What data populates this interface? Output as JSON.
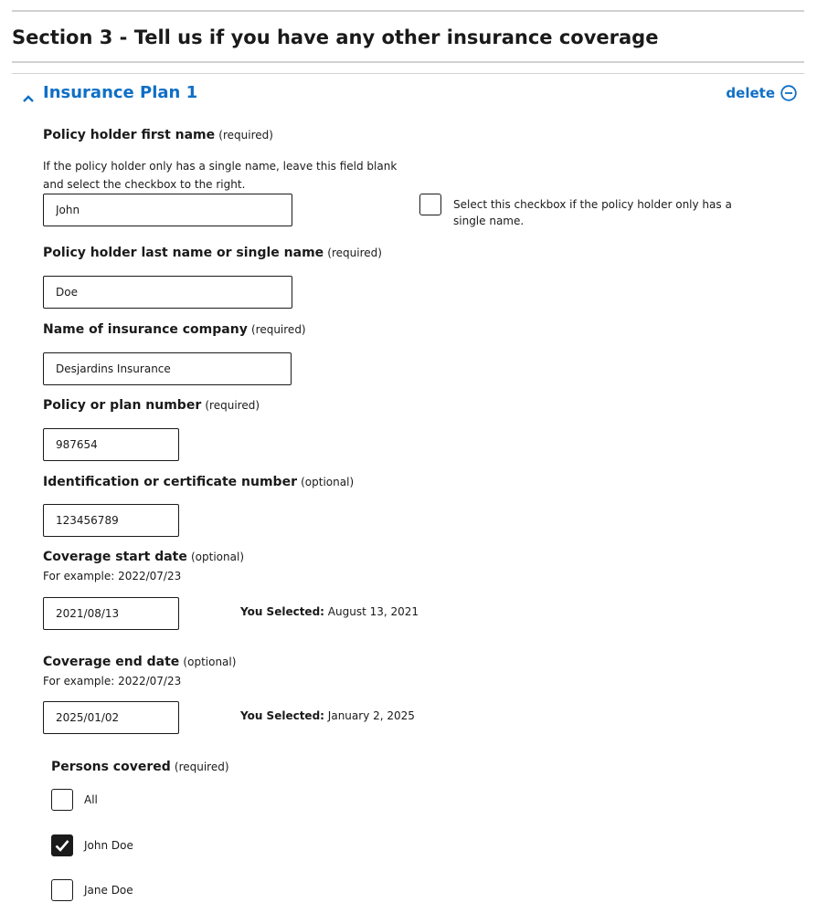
{
  "section": {
    "title": "Section 3 - Tell us if you have any other insurance coverage"
  },
  "plan": {
    "title": "Insurance Plan 1",
    "delete_label": "delete"
  },
  "first_name": {
    "label": "Policy holder first name",
    "hint": "(required)",
    "help_line1": "If the policy holder only has a single name, leave this field blank",
    "help_line2": "and select the checkbox to the right.",
    "value": "John",
    "single_name_checkbox_label": "Select this checkbox if the policy holder only has a single name.",
    "single_name_checked": false
  },
  "last_name": {
    "label": "Policy holder last name or single name",
    "hint": "(required)",
    "value": "Doe"
  },
  "company": {
    "label": "Name of insurance company",
    "hint": "(required)",
    "value": "Desjardins Insurance"
  },
  "policy_number": {
    "label": "Policy or plan number",
    "hint": "(required)",
    "value": "987654"
  },
  "certificate_number": {
    "label": "Identification or certificate number",
    "hint": "(optional)",
    "value": "123456789"
  },
  "start_date": {
    "label": "Coverage start date",
    "hint": "(optional)",
    "example": "For example: 2022/07/23",
    "value": "2021/08/13",
    "selected_prefix": "You Selected:",
    "selected_text": "August 13, 2021"
  },
  "end_date": {
    "label": "Coverage end date",
    "hint": "(optional)",
    "example": "For example: 2022/07/23",
    "value": "2025/01/02",
    "selected_prefix": "You Selected:",
    "selected_text": "January 2, 2025"
  },
  "persons_covered": {
    "label": "Persons covered",
    "hint": "(required)",
    "options": [
      {
        "label": "All",
        "checked": false
      },
      {
        "label": "John Doe",
        "checked": true
      },
      {
        "label": "Jane Doe",
        "checked": false
      }
    ]
  },
  "colors": {
    "link": "#0f6fc6",
    "text": "#1a1a1a",
    "rule": "#d1d1d1"
  }
}
